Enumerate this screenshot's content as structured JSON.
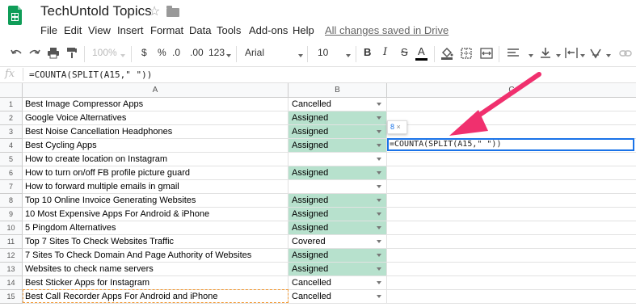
{
  "app": {
    "doc_title": "TechUntold Topics",
    "save_status": "All changes saved in Drive"
  },
  "menu": [
    "File",
    "Edit",
    "View",
    "Insert",
    "Format",
    "Data",
    "Tools",
    "Add-ons",
    "Help"
  ],
  "toolbar": {
    "zoom": "100%",
    "currency": "$",
    "percent": "%",
    "decrease_decimals": ".0",
    "increase_decimals": ".00",
    "more_formats": "123",
    "font": "Arial",
    "font_size": "10",
    "bold": "B",
    "italic": "I",
    "strikethrough": "S",
    "text_color": "A"
  },
  "formula_bar": {
    "fx": "fx",
    "formula": "=COUNTA(SPLIT(A15,\" \"))"
  },
  "columns": [
    "A",
    "B",
    "C"
  ],
  "rows": [
    {
      "num": "1",
      "a": "Best Image Compressor Apps",
      "b": "Cancelled"
    },
    {
      "num": "2",
      "a": "Google Voice Alternatives",
      "b": "Assigned"
    },
    {
      "num": "3",
      "a": "Best Noise Cancellation Headphones",
      "b": "Assigned"
    },
    {
      "num": "4",
      "a": "Best Cycling Apps",
      "b": "Assigned"
    },
    {
      "num": "5",
      "a": "How to create location on Instagram",
      "b": ""
    },
    {
      "num": "6",
      "a": "How to turn on/off FB profile picture guard",
      "b": "Assigned"
    },
    {
      "num": "7",
      "a": "How to forward multiple emails in gmail",
      "b": ""
    },
    {
      "num": "8",
      "a": "Top 10 Online Invoice Generating Websites",
      "b": "Assigned"
    },
    {
      "num": "9",
      "a": "10 Most Expensive Apps For Android & iPhone",
      "b": "Assigned"
    },
    {
      "num": "10",
      "a": "5 Pingdom Alternatives",
      "b": "Assigned"
    },
    {
      "num": "11",
      "a": "Top 7 Sites To Check Websites Traffic",
      "b": "Covered"
    },
    {
      "num": "12",
      "a": "7 Sites To Check Domain And Page Authority of Websites",
      "b": "Assigned"
    },
    {
      "num": "13",
      "a": "Websites to check name servers",
      "b": "Assigned"
    },
    {
      "num": "14",
      "a": "Best Sticker Apps for Instagram",
      "b": "Cancelled"
    },
    {
      "num": "15",
      "a": "Best Call Recorder Apps For Android and iPhone",
      "b": "Cancelled"
    }
  ],
  "active_cell": {
    "formula": "=COUNTA(SPLIT(A15,\" \"))",
    "result_preview": "8"
  },
  "colors": {
    "assigned_fill": "#b7e1cd",
    "selection": "#1a73e8",
    "copy_marquee": "#f29b38",
    "arrow": "#f0306e"
  }
}
